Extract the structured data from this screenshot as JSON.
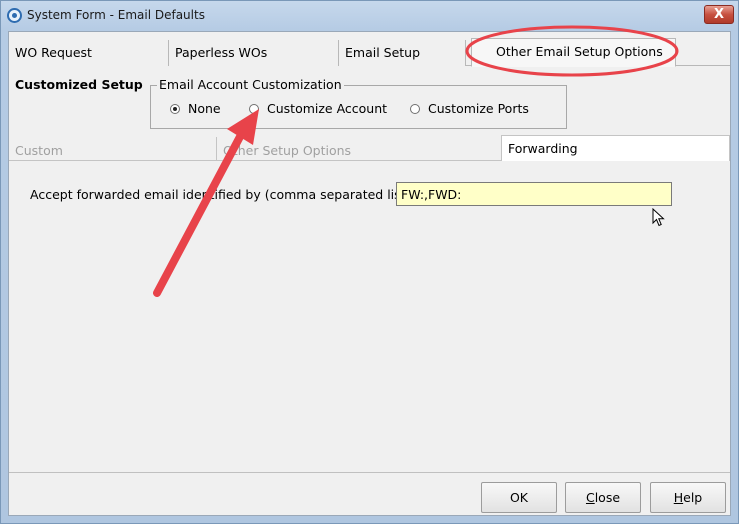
{
  "window": {
    "title": "System Form - Email Defaults",
    "close_glyph": "X"
  },
  "tabs": [
    "WO Request",
    "Paperless WOs",
    "Email Setup",
    "Other Email Setup Options"
  ],
  "customized_setup_label": "Customized Setup",
  "email_account_group": {
    "legend": "Email Account Customization",
    "options": [
      "None",
      "Customize Account",
      "Customize Ports"
    ],
    "selected": "None"
  },
  "subtabs": [
    "Custom",
    "Other Setup Options",
    "Forwarding"
  ],
  "forwarding": {
    "label": "Accept forwarded email identified by (comma separated list):",
    "value": "FW:,FWD:"
  },
  "buttons": {
    "ok": "OK",
    "close": {
      "first": "C",
      "rest": "lose"
    },
    "help": {
      "first": "H",
      "rest": "elp"
    }
  },
  "annotation_colors": {
    "arrow": "#e8434a",
    "circle": "#e8434a"
  },
  "icons": {
    "app": "gear-icon",
    "close": "close-icon",
    "cursor": "mouse-pointer-icon"
  }
}
